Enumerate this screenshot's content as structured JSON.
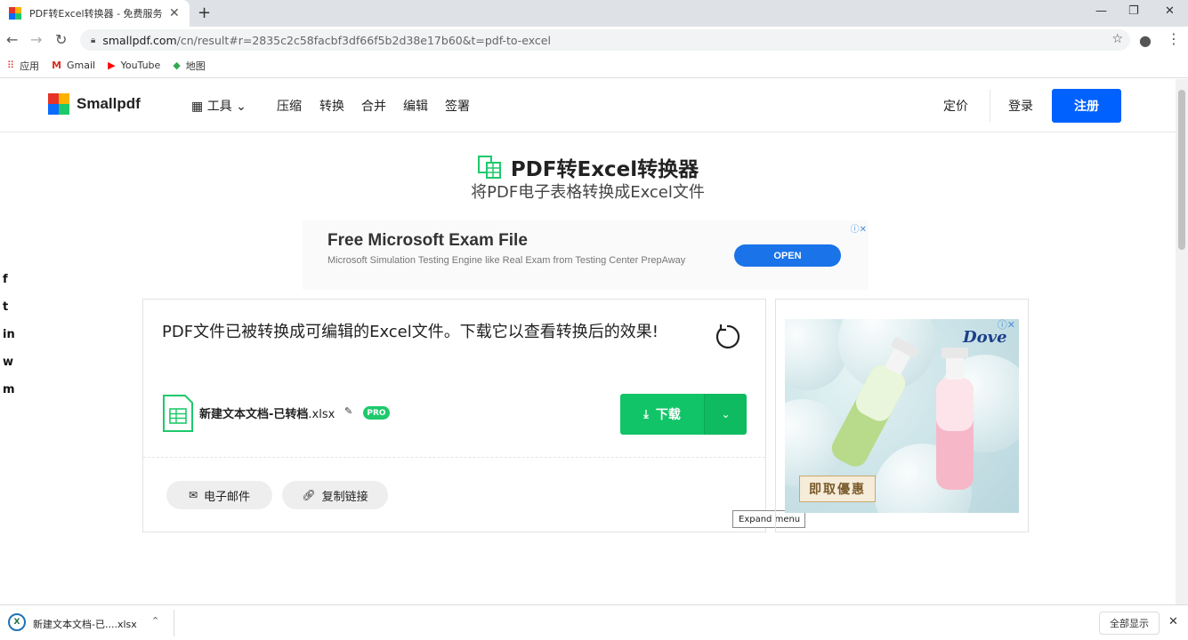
{
  "browser": {
    "tab_title": "PDF转Excel转换器 - 免费服务",
    "new_tab": "+",
    "url_main": "smallpdf.com",
    "url_rest": "/cn/result#r=2835c2c58facbf3df66f5b2d38e17b60&t=pdf-to-excel",
    "bookmarks": [
      {
        "label": "应用",
        "icon": "apps-grid-icon"
      },
      {
        "label": "Gmail",
        "icon": "gmail-icon"
      },
      {
        "label": "YouTube",
        "icon": "youtube-icon"
      },
      {
        "label": "地图",
        "icon": "maps-icon"
      }
    ]
  },
  "header": {
    "logo": "Smallpdf",
    "tools_label": "工具",
    "nav": [
      "压缩",
      "转换",
      "合并",
      "编辑",
      "签署"
    ],
    "pricing": "定价",
    "login": "登录",
    "signup": "注册"
  },
  "hero": {
    "title": "PDF转Excel转换器",
    "subtitle": "将PDF电子表格转换成Excel文件"
  },
  "ad_banner": {
    "title": "Free Microsoft Exam File",
    "desc": "Microsoft Simulation Testing Engine like Real Exam from Testing Center PrepAway",
    "cta": "OPEN"
  },
  "result": {
    "message": "PDF文件已被转换成可编辑的Excel文件。下载它以查看转换后的效果!",
    "file_base": "新建文本文档-已转档",
    "file_ext": ".xlsx",
    "pro_badge": "PRO",
    "download_label": "下载",
    "tooltip": "Expand menu",
    "email_label": "电子邮件",
    "copy_link_label": "复制链接"
  },
  "side_ad": {
    "brand": "Dove",
    "cta": "即取優惠"
  },
  "social": [
    "f",
    "t",
    "in",
    "w",
    "m"
  ],
  "download_bar": {
    "item_name": "新建文本文档-已....xlsx",
    "show_all": "全部显示"
  },
  "colors": {
    "signup_blue": "#0061fe",
    "download_green": "#11c467",
    "pro_green": "#1ec96b"
  }
}
